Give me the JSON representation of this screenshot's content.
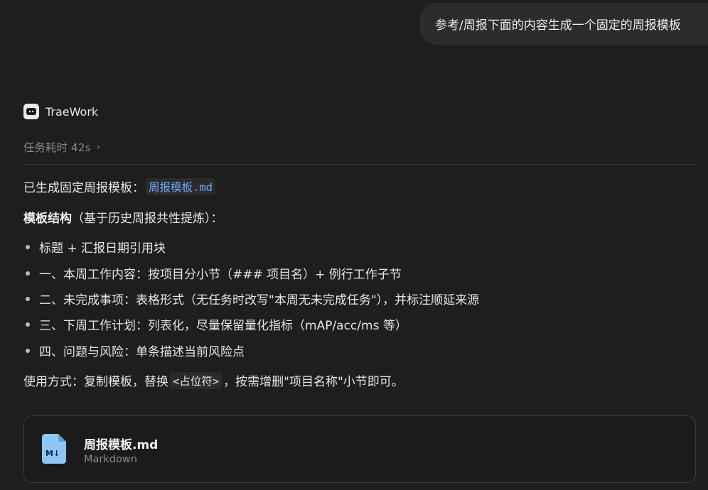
{
  "user_message": "参考/周报下面的内容生成一个固定的周报模板",
  "agent": {
    "name": "TraeWork",
    "icon": "traework-logo-icon"
  },
  "task_duration": "任务耗时 42s",
  "response": {
    "line1_prefix": "已生成固定周报模板：",
    "line1_file": "周报模板.md",
    "structure_title": "模板结构",
    "structure_note": "（基于历史周报共性提炼）：",
    "bullets": [
      "标题 + 汇报日期引用块",
      "一、本周工作内容：按项目分小节（### 项目名）+ 例行工作子节",
      "二、未完成事项：表格形式（无任务时改写\"本周无未完成任务\"），并标注顺延来源",
      "三、下周工作计划：列表化，尽量保留量化指标（mAP/acc/ms 等）",
      "四、问题与风险：单条描述当前风险点"
    ],
    "usage_prefix": "使用方式：复制模板，替换",
    "usage_placeholder": "<占位符>",
    "usage_suffix": "，按需增删\"项目名称\"小节即可。"
  },
  "file_card": {
    "name": "周报模板.md",
    "type": "Markdown",
    "icon": "markdown-file-icon",
    "icon_color": "#8ec5f5"
  }
}
